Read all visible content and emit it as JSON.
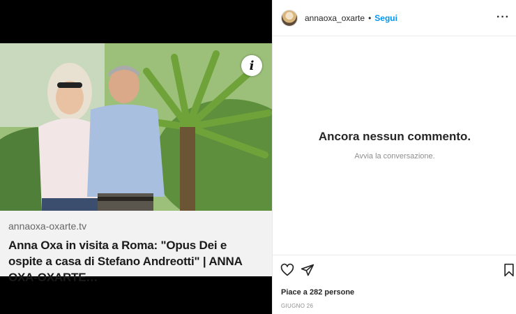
{
  "media": {
    "info_icon_glyph": "i",
    "link": {
      "domain": "annaoxa-oxarte.tv",
      "title": "Anna Oxa in visita a Roma: \"Opus Dei e ospite a casa di Stefano Andreotti\" | ANNA OXA-OXARTE…"
    }
  },
  "header": {
    "username": "annaoxa_oxarte",
    "separator": "•",
    "follow_label": "Segui",
    "more_label": "···"
  },
  "comments": {
    "empty_title": "Ancora nessun commento.",
    "empty_subtitle": "Avvia la conversazione."
  },
  "actions": {
    "icons": [
      "heart-icon",
      "share-icon",
      "bookmark-icon"
    ]
  },
  "likes_text": "Piace a 282 persone",
  "date_text": "GIUGNO 26",
  "colors": {
    "follow": "#0095f6",
    "media_bg": "#000000",
    "link_card_bg": "#f2f2f2"
  }
}
